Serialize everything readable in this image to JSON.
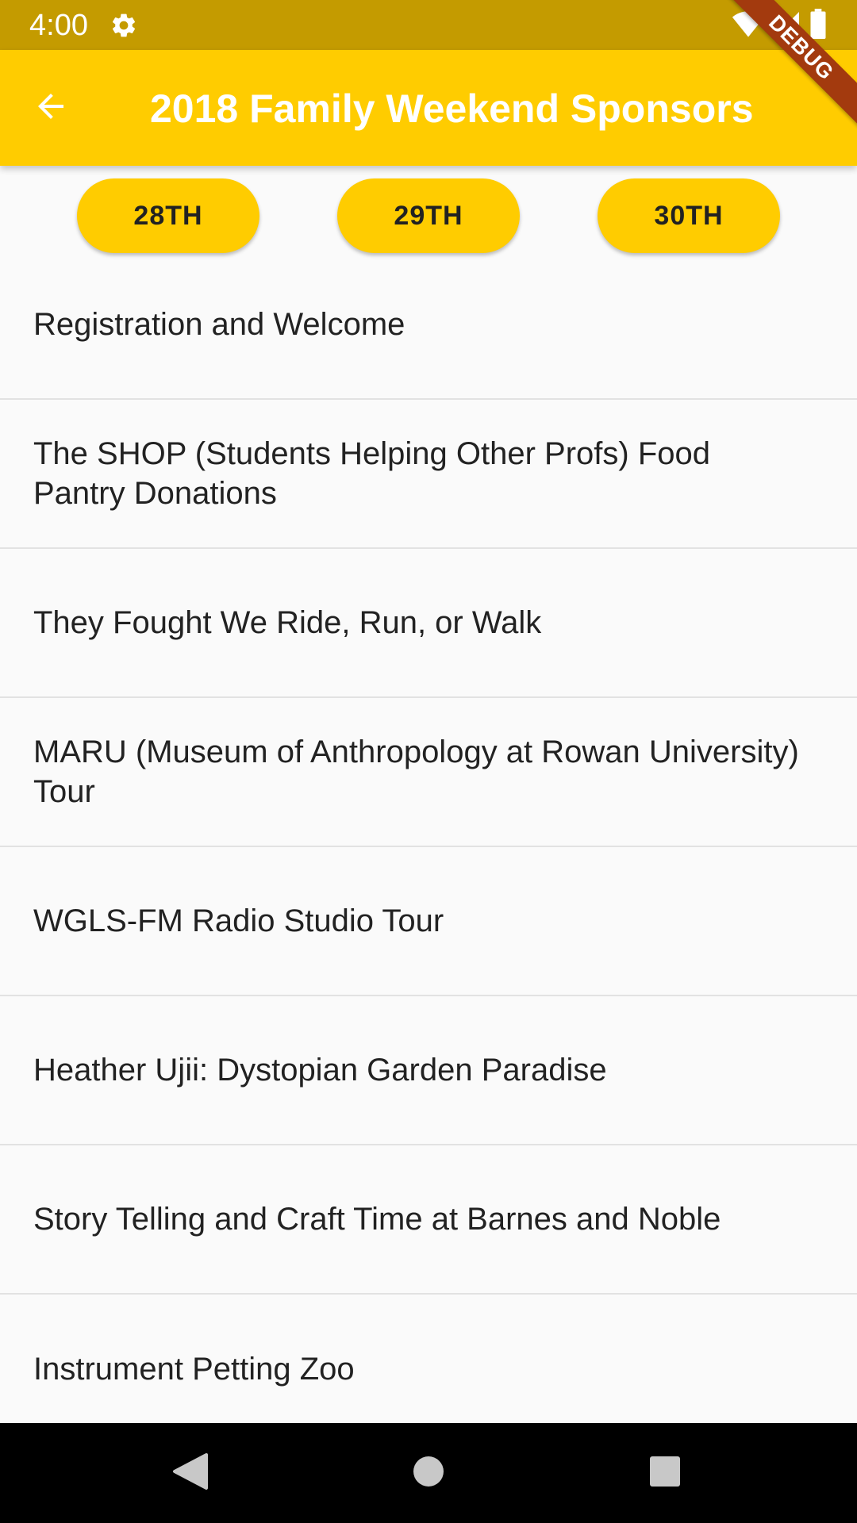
{
  "status_bar": {
    "time": "4:00",
    "icons": [
      "gear-icon",
      "wifi-icon",
      "signal-icon",
      "battery-icon"
    ],
    "background": "#c49b00"
  },
  "app_bar": {
    "title": "2018 Family Weekend Sponsors",
    "back_icon": "arrow-back-icon",
    "background": "#ffcc00"
  },
  "debug_banner": {
    "label": "DEBUG",
    "color": "#a33a0e"
  },
  "days": [
    {
      "label": "28TH"
    },
    {
      "label": "29TH"
    },
    {
      "label": "30TH"
    }
  ],
  "events": [
    {
      "title": "Registration and Welcome"
    },
    {
      "title": "The SHOP (Students Helping Other Profs) Food Pantry Donations"
    },
    {
      "title": "They Fought We Ride, Run, or Walk"
    },
    {
      "title": "MARU (Museum of Anthropology at Rowan University) Tour"
    },
    {
      "title": "WGLS-FM Radio Studio Tour"
    },
    {
      "title": "Heather Ujii: Dystopian Garden Paradise"
    },
    {
      "title": "Story Telling and Craft Time at Barnes and Noble"
    },
    {
      "title": "Instrument Petting Zoo"
    }
  ],
  "nav_bar": {
    "icons": [
      "nav-back-icon",
      "nav-home-icon",
      "nav-recents-icon"
    ]
  }
}
